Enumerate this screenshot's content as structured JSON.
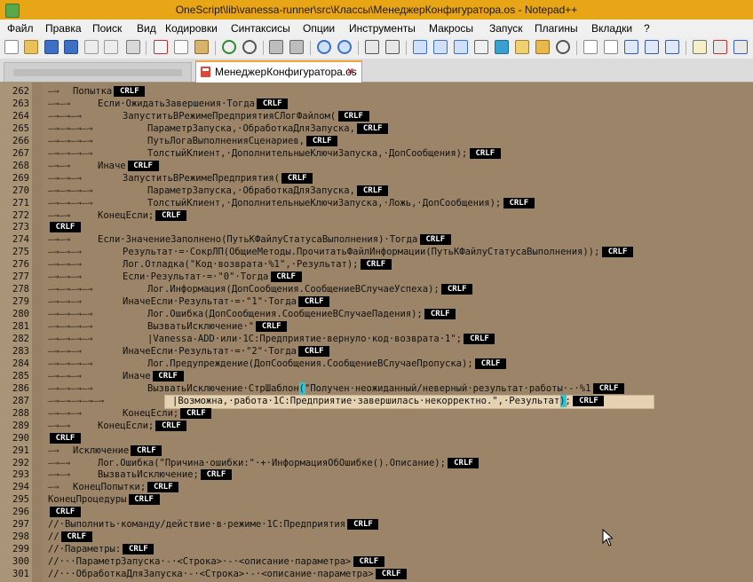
{
  "window": {
    "title": "OneScript\\lib\\vanessa-runner\\src\\Классы\\МенеджерКонфигуратора.os - Notepad++"
  },
  "menu": [
    "Файл",
    "Правка",
    "Поиск",
    "Вид",
    "Кодировки",
    "Синтаксисы",
    "Опции",
    "Инструменты",
    "Макросы",
    "Запуск",
    "Плагины",
    "Вкладки",
    "?"
  ],
  "tabs": {
    "active": "МенеджерКонфигуратора.os",
    "close_glyph": "×"
  },
  "eol_marker": "CRLF",
  "colors": {
    "editor_bg": "#9b8468",
    "current_line": "#e5d2b2",
    "brace_match": "#2fc3d6",
    "eol_badge": "#000000"
  },
  "lines": [
    {
      "n": "262",
      "ind": "—→",
      "code": "Попытка"
    },
    {
      "n": "263",
      "ind": "—→—→",
      "code": "Если·ОжидатьЗавершения·Тогда"
    },
    {
      "n": "264",
      "ind": "—→—→—→",
      "code": "ЗапуститьВРежимеПредприятияСЛогФайлом("
    },
    {
      "n": "265",
      "ind": "—→—→—→—→",
      "code": "ПараметрЗапуска,·ОбработкаДляЗапуска,"
    },
    {
      "n": "266",
      "ind": "—→—→—→—→",
      "code": "ПутьЛогаВыполненияСценариев,"
    },
    {
      "n": "267",
      "ind": "—→—→—→—→",
      "code": "ТолстыйКлиент,·ДополнительныеКлючиЗапуска,·ДопСообщения);"
    },
    {
      "n": "268",
      "ind": "—→—→",
      "code": "Иначе"
    },
    {
      "n": "269",
      "ind": "—→—→—→",
      "code": "ЗапуститьВРежимеПредприятия("
    },
    {
      "n": "270",
      "ind": "—→—→—→—→",
      "code": "ПараметрЗапуска,·ОбработкаДляЗапуска,"
    },
    {
      "n": "271",
      "ind": "—→—→—→—→",
      "code": "ТолстыйКлиент,·ДополнительныеКлючиЗапуска,·Ложь,·ДопСообщения);"
    },
    {
      "n": "272",
      "ind": "—→—→",
      "code": "КонецЕсли;"
    },
    {
      "n": "273",
      "ind": "",
      "code": ""
    },
    {
      "n": "274",
      "ind": "—→—→",
      "code": "Если·ЗначениеЗаполнено(ПутьКФайлуСтатусаВыполнения)·Тогда"
    },
    {
      "n": "275",
      "ind": "—→—→—→",
      "code": "Результат·=·СокрЛП(ОбщиеМетоды.ПрочитатьФайлИнформации(ПутьКФайлуСтатусаВыполнения));"
    },
    {
      "n": "276",
      "ind": "—→—→—→",
      "code": "Лог.Отладка(\"Код·возврата·%1\",·Результат);"
    },
    {
      "n": "277",
      "ind": "—→—→—→",
      "code": "Если·Результат·=·\"0\"·Тогда"
    },
    {
      "n": "278",
      "ind": "—→—→—→—→",
      "code": "Лог.Информация(ДопСообщения.СообщениеВСлучаеУспеха);"
    },
    {
      "n": "279",
      "ind": "—→—→—→",
      "code": "ИначеЕсли·Результат·=·\"1\"·Тогда"
    },
    {
      "n": "280",
      "ind": "—→—→—→—→",
      "code": "Лог.Ошибка(ДопСообщения.СообщениеВСлучаеПадения);"
    },
    {
      "n": "281",
      "ind": "—→—→—→—→",
      "code": "ВызватьИсключение·\""
    },
    {
      "n": "282",
      "ind": "—→—→—→—→",
      "code": "|Vanessa-ADD·или·1С:Предприятие·вернуло·код·возврата·1\";"
    },
    {
      "n": "283",
      "ind": "—→—→—→",
      "code": "ИначеЕсли·Результат·=·\"2\"·Тогда"
    },
    {
      "n": "284",
      "ind": "—→—→—→—→",
      "code": "Лог.Предупреждение(ДопСообщения.СообщениеВСлучаеПропуска);"
    },
    {
      "n": "285",
      "ind": "—→—→—→",
      "code": "Иначе"
    },
    {
      "n": "286",
      "ind": "—→—→—→—→",
      "code": "ВызватьИсключение·СтрШаблон(\"Получен·неожиданный/неверный·результат·работы·-·%1"
    },
    {
      "n": "287",
      "ind": "—→—→—→—→—→",
      "code": "|Возможна,·работа·1С:Предприятие·завершилась·некорректно.\",·Результат);"
    },
    {
      "n": "288",
      "ind": "—→—→—→",
      "code": "КонецЕсли;"
    },
    {
      "n": "289",
      "ind": "—→—→",
      "code": "КонецЕсли;"
    },
    {
      "n": "290",
      "ind": "",
      "code": ""
    },
    {
      "n": "291",
      "ind": "—→",
      "code": "Исключение"
    },
    {
      "n": "292",
      "ind": "—→—→",
      "code": "Лог.Ошибка(\"Причина·ошибки:\"·+·ИнформацияОбОшибке().Описание);"
    },
    {
      "n": "293",
      "ind": "—→—→",
      "code": "ВызватьИсключение;"
    },
    {
      "n": "294",
      "ind": "—→",
      "code": "КонецПопытки;"
    },
    {
      "n": "295",
      "ind": "",
      "code": "КонецПроцедуры"
    },
    {
      "n": "296",
      "ind": "",
      "code": ""
    },
    {
      "n": "297",
      "ind": "",
      "code": "//·Выполнить·команду/действие·в·режиме·1С:Предприятия"
    },
    {
      "n": "298",
      "ind": "",
      "code": "//"
    },
    {
      "n": "299",
      "ind": "",
      "code": "//·Параметры:"
    },
    {
      "n": "300",
      "ind": "",
      "code": "//···ПараметрЗапуска·-·<Строка>·-·<описание·параметра>"
    },
    {
      "n": "301",
      "ind": "",
      "code": "//···ОбработкаДляЗапуска·-·<Строка>·-·<описание·параметра>"
    }
  ]
}
